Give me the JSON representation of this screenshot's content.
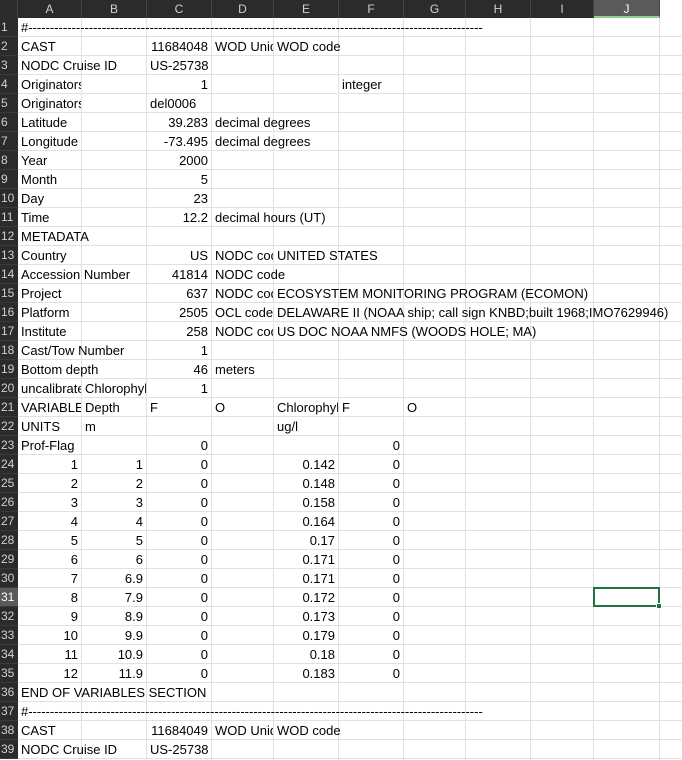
{
  "columns": [
    "A",
    "B",
    "C",
    "D",
    "E",
    "F",
    "G",
    "H",
    "I",
    "J"
  ],
  "selected_column": "J",
  "selected_row": 31,
  "rows": [
    {
      "r": 1,
      "cells": [
        {
          "c": 0,
          "v": "#---------------------------------------------------------------------------------------------------------"
        }
      ]
    },
    {
      "r": 2,
      "cells": [
        {
          "c": 0,
          "v": "CAST"
        },
        {
          "c": 2,
          "v": "11684048",
          "num": true
        },
        {
          "c": 3,
          "v": "WOD Unique Cast",
          "clip": true
        },
        {
          "c": 4,
          "v": "WOD code"
        }
      ]
    },
    {
      "r": 3,
      "cells": [
        {
          "c": 0,
          "v": "NODC Cruise ID"
        },
        {
          "c": 2,
          "v": "US-25738"
        }
      ]
    },
    {
      "r": 4,
      "cells": [
        {
          "c": 0,
          "v": "Originators Station ID",
          "clip": true
        },
        {
          "c": 2,
          "v": "1",
          "num": true
        },
        {
          "c": 5,
          "v": "integer"
        }
      ]
    },
    {
      "r": 5,
      "cells": [
        {
          "c": 0,
          "v": "Originators Cruise ID",
          "clip": true
        },
        {
          "c": 2,
          "v": "del0006"
        }
      ]
    },
    {
      "r": 6,
      "cells": [
        {
          "c": 0,
          "v": "Latitude"
        },
        {
          "c": 2,
          "v": "39.283",
          "num": true
        },
        {
          "c": 3,
          "v": "decimal degrees"
        }
      ]
    },
    {
      "r": 7,
      "cells": [
        {
          "c": 0,
          "v": "Longitude"
        },
        {
          "c": 2,
          "v": "-73.495",
          "num": true
        },
        {
          "c": 3,
          "v": "decimal degrees"
        }
      ]
    },
    {
      "r": 8,
      "cells": [
        {
          "c": 0,
          "v": "Year"
        },
        {
          "c": 2,
          "v": "2000",
          "num": true
        }
      ]
    },
    {
      "r": 9,
      "cells": [
        {
          "c": 0,
          "v": "Month"
        },
        {
          "c": 2,
          "v": "5",
          "num": true
        }
      ]
    },
    {
      "r": 10,
      "cells": [
        {
          "c": 0,
          "v": "Day"
        },
        {
          "c": 2,
          "v": "23",
          "num": true
        }
      ]
    },
    {
      "r": 11,
      "cells": [
        {
          "c": 0,
          "v": "Time"
        },
        {
          "c": 2,
          "v": "12.2",
          "num": true
        },
        {
          "c": 3,
          "v": "decimal hours (UT)"
        }
      ]
    },
    {
      "r": 12,
      "cells": [
        {
          "c": 0,
          "v": "METADATA"
        }
      ]
    },
    {
      "r": 13,
      "cells": [
        {
          "c": 0,
          "v": "Country"
        },
        {
          "c": 2,
          "v": "US",
          "num": true
        },
        {
          "c": 3,
          "v": "NODC code",
          "clip": true
        },
        {
          "c": 4,
          "v": "UNITED STATES"
        }
      ]
    },
    {
      "r": 14,
      "cells": [
        {
          "c": 0,
          "v": "Accession Number"
        },
        {
          "c": 2,
          "v": "41814",
          "num": true
        },
        {
          "c": 3,
          "v": "NODC code"
        }
      ]
    },
    {
      "r": 15,
      "cells": [
        {
          "c": 0,
          "v": "Project"
        },
        {
          "c": 2,
          "v": "637",
          "num": true
        },
        {
          "c": 3,
          "v": "NODC code",
          "clip": true
        },
        {
          "c": 4,
          "v": "ECOSYSTEM MONITORING PROGRAM (ECOMON)"
        }
      ]
    },
    {
      "r": 16,
      "cells": [
        {
          "c": 0,
          "v": "Platform"
        },
        {
          "c": 2,
          "v": "2505",
          "num": true
        },
        {
          "c": 3,
          "v": "OCL code",
          "clip": true
        },
        {
          "c": 4,
          "v": "DELAWARE II (NOAA ship; call sign KNBD;built 1968;IMO7629946)"
        }
      ]
    },
    {
      "r": 17,
      "cells": [
        {
          "c": 0,
          "v": "Institute"
        },
        {
          "c": 2,
          "v": "258",
          "num": true
        },
        {
          "c": 3,
          "v": "NODC code",
          "clip": true
        },
        {
          "c": 4,
          "v": "US DOC NOAA NMFS (WOODS HOLE; MA)"
        }
      ]
    },
    {
      "r": 18,
      "cells": [
        {
          "c": 0,
          "v": "Cast/Tow Number"
        },
        {
          "c": 2,
          "v": "1",
          "num": true
        }
      ]
    },
    {
      "r": 19,
      "cells": [
        {
          "c": 0,
          "v": "Bottom depth"
        },
        {
          "c": 2,
          "v": "46",
          "num": true
        },
        {
          "c": 3,
          "v": "meters"
        }
      ]
    },
    {
      "r": 20,
      "cells": [
        {
          "c": 0,
          "v": "uncalibrated",
          "clip": true
        },
        {
          "c": 1,
          "v": "Chlorophyll",
          "clip": true
        },
        {
          "c": 2,
          "v": "1",
          "num": true
        }
      ]
    },
    {
      "r": 21,
      "cells": [
        {
          "c": 0,
          "v": "VARIABLES",
          "clip": true
        },
        {
          "c": 1,
          "v": "Depth"
        },
        {
          "c": 2,
          "v": "F"
        },
        {
          "c": 3,
          "v": "O"
        },
        {
          "c": 4,
          "v": "Chlorophyll",
          "clip": true
        },
        {
          "c": 5,
          "v": "F"
        },
        {
          "c": 6,
          "v": "O"
        }
      ]
    },
    {
      "r": 22,
      "cells": [
        {
          "c": 0,
          "v": "UNITS"
        },
        {
          "c": 1,
          "v": "m"
        },
        {
          "c": 4,
          "v": "ug/l"
        }
      ]
    },
    {
      "r": 23,
      "cells": [
        {
          "c": 0,
          "v": "Prof-Flag"
        },
        {
          "c": 2,
          "v": "0",
          "num": true
        },
        {
          "c": 5,
          "v": "0",
          "num": true
        }
      ]
    },
    {
      "r": 24,
      "cells": [
        {
          "c": 0,
          "v": "1",
          "num": true
        },
        {
          "c": 1,
          "v": "1",
          "num": true
        },
        {
          "c": 2,
          "v": "0",
          "num": true
        },
        {
          "c": 4,
          "v": "0.142",
          "num": true
        },
        {
          "c": 5,
          "v": "0",
          "num": true
        }
      ]
    },
    {
      "r": 25,
      "cells": [
        {
          "c": 0,
          "v": "2",
          "num": true
        },
        {
          "c": 1,
          "v": "2",
          "num": true
        },
        {
          "c": 2,
          "v": "0",
          "num": true
        },
        {
          "c": 4,
          "v": "0.148",
          "num": true
        },
        {
          "c": 5,
          "v": "0",
          "num": true
        }
      ]
    },
    {
      "r": 26,
      "cells": [
        {
          "c": 0,
          "v": "3",
          "num": true
        },
        {
          "c": 1,
          "v": "3",
          "num": true
        },
        {
          "c": 2,
          "v": "0",
          "num": true
        },
        {
          "c": 4,
          "v": "0.158",
          "num": true
        },
        {
          "c": 5,
          "v": "0",
          "num": true
        }
      ]
    },
    {
      "r": 27,
      "cells": [
        {
          "c": 0,
          "v": "4",
          "num": true
        },
        {
          "c": 1,
          "v": "4",
          "num": true
        },
        {
          "c": 2,
          "v": "0",
          "num": true
        },
        {
          "c": 4,
          "v": "0.164",
          "num": true
        },
        {
          "c": 5,
          "v": "0",
          "num": true
        }
      ]
    },
    {
      "r": 28,
      "cells": [
        {
          "c": 0,
          "v": "5",
          "num": true
        },
        {
          "c": 1,
          "v": "5",
          "num": true
        },
        {
          "c": 2,
          "v": "0",
          "num": true
        },
        {
          "c": 4,
          "v": "0.17",
          "num": true
        },
        {
          "c": 5,
          "v": "0",
          "num": true
        }
      ]
    },
    {
      "r": 29,
      "cells": [
        {
          "c": 0,
          "v": "6",
          "num": true
        },
        {
          "c": 1,
          "v": "6",
          "num": true
        },
        {
          "c": 2,
          "v": "0",
          "num": true
        },
        {
          "c": 4,
          "v": "0.171",
          "num": true
        },
        {
          "c": 5,
          "v": "0",
          "num": true
        }
      ]
    },
    {
      "r": 30,
      "cells": [
        {
          "c": 0,
          "v": "7",
          "num": true
        },
        {
          "c": 1,
          "v": "6.9",
          "num": true
        },
        {
          "c": 2,
          "v": "0",
          "num": true
        },
        {
          "c": 4,
          "v": "0.171",
          "num": true
        },
        {
          "c": 5,
          "v": "0",
          "num": true
        }
      ]
    },
    {
      "r": 31,
      "cells": [
        {
          "c": 0,
          "v": "8",
          "num": true
        },
        {
          "c": 1,
          "v": "7.9",
          "num": true
        },
        {
          "c": 2,
          "v": "0",
          "num": true
        },
        {
          "c": 4,
          "v": "0.172",
          "num": true
        },
        {
          "c": 5,
          "v": "0",
          "num": true
        }
      ]
    },
    {
      "r": 32,
      "cells": [
        {
          "c": 0,
          "v": "9",
          "num": true
        },
        {
          "c": 1,
          "v": "8.9",
          "num": true
        },
        {
          "c": 2,
          "v": "0",
          "num": true
        },
        {
          "c": 4,
          "v": "0.173",
          "num": true
        },
        {
          "c": 5,
          "v": "0",
          "num": true
        }
      ]
    },
    {
      "r": 33,
      "cells": [
        {
          "c": 0,
          "v": "10",
          "num": true
        },
        {
          "c": 1,
          "v": "9.9",
          "num": true
        },
        {
          "c": 2,
          "v": "0",
          "num": true
        },
        {
          "c": 4,
          "v": "0.179",
          "num": true
        },
        {
          "c": 5,
          "v": "0",
          "num": true
        }
      ]
    },
    {
      "r": 34,
      "cells": [
        {
          "c": 0,
          "v": "11",
          "num": true
        },
        {
          "c": 1,
          "v": "10.9",
          "num": true
        },
        {
          "c": 2,
          "v": "0",
          "num": true
        },
        {
          "c": 4,
          "v": "0.18",
          "num": true
        },
        {
          "c": 5,
          "v": "0",
          "num": true
        }
      ]
    },
    {
      "r": 35,
      "cells": [
        {
          "c": 0,
          "v": "12",
          "num": true
        },
        {
          "c": 1,
          "v": "11.9",
          "num": true
        },
        {
          "c": 2,
          "v": "0",
          "num": true
        },
        {
          "c": 4,
          "v": "0.183",
          "num": true
        },
        {
          "c": 5,
          "v": "0",
          "num": true
        }
      ]
    },
    {
      "r": 36,
      "cells": [
        {
          "c": 0,
          "v": "END OF VARIABLES SECTION"
        }
      ]
    },
    {
      "r": 37,
      "cells": [
        {
          "c": 0,
          "v": "#---------------------------------------------------------------------------------------------------------"
        }
      ]
    },
    {
      "r": 38,
      "cells": [
        {
          "c": 0,
          "v": "CAST"
        },
        {
          "c": 2,
          "v": "11684049",
          "num": true
        },
        {
          "c": 3,
          "v": "WOD Unique Cast",
          "clip": true
        },
        {
          "c": 4,
          "v": "WOD code"
        }
      ]
    },
    {
      "r": 39,
      "cells": [
        {
          "c": 0,
          "v": "NODC Cruise ID"
        },
        {
          "c": 2,
          "v": "US-25738"
        }
      ]
    }
  ]
}
